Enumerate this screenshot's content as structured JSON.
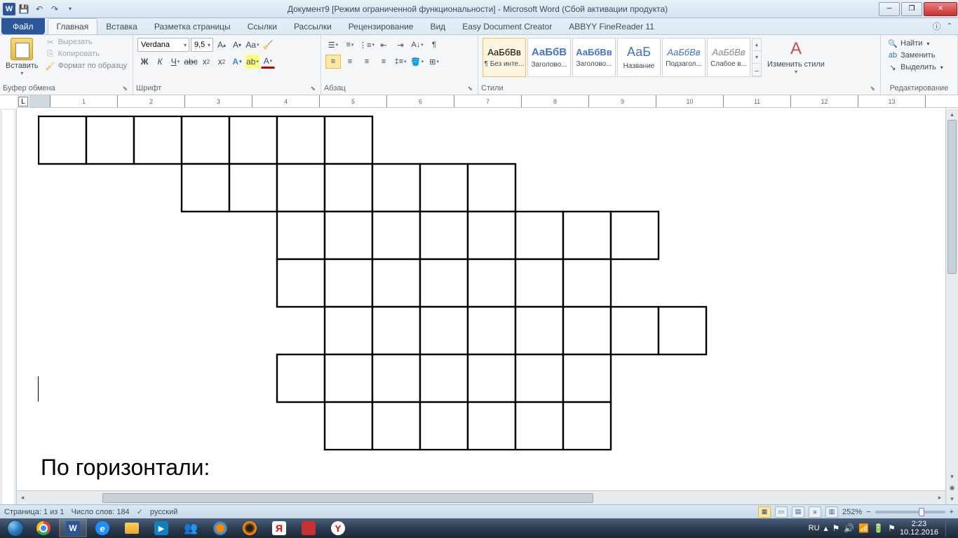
{
  "titlebar": {
    "text": "Документ9 [Режим ограниченной функциональности]  -  Microsoft Word (Сбой активации продукта)"
  },
  "tabs": {
    "file": "Файл",
    "items": [
      "Главная",
      "Вставка",
      "Разметка страницы",
      "Ссылки",
      "Рассылки",
      "Рецензирование",
      "Вид",
      "Easy Document Creator",
      "ABBYY FineReader 11"
    ]
  },
  "ribbon": {
    "clipboard": {
      "paste": "Вставить",
      "cut": "Вырезать",
      "copy": "Копировать",
      "format_painter": "Формат по образцу",
      "label": "Буфер обмена"
    },
    "font": {
      "name": "Verdana",
      "size": "9,5",
      "label": "Шрифт"
    },
    "paragraph": {
      "label": "Абзац"
    },
    "styles": {
      "items": [
        {
          "preview": "АаБбВв",
          "name": "¶ Без инте..."
        },
        {
          "preview": "АаБбВ",
          "name": "Заголово..."
        },
        {
          "preview": "АаБбВв",
          "name": "Заголово..."
        },
        {
          "preview": "АаБ",
          "name": "Название"
        },
        {
          "preview": "АаБбВв",
          "name": "Подзагол..."
        },
        {
          "preview": "АаБбВв",
          "name": "Слабое в..."
        }
      ],
      "change": "Изменить стили",
      "label": "Стили"
    },
    "editing": {
      "find": "Найти",
      "replace": "Заменить",
      "select": "Выделить",
      "label": "Редактирование"
    }
  },
  "document": {
    "heading": "По горизонтали:",
    "crossword_rows": [
      {
        "start": 0,
        "len": 7
      },
      {
        "start": 3,
        "len": 7
      },
      {
        "start": 5,
        "len": 8
      },
      {
        "start": 5,
        "len": 7
      },
      {
        "start": 6,
        "len": 8
      },
      {
        "start": 5,
        "len": 7
      },
      {
        "start": 6,
        "len": 6
      }
    ]
  },
  "statusbar": {
    "page": "Страница: 1 из 1",
    "words": "Число слов: 184",
    "lang": "русский",
    "zoom": "252%"
  },
  "taskbar": {
    "lang": "RU",
    "time": "2:23",
    "date": "10.12.2016"
  }
}
